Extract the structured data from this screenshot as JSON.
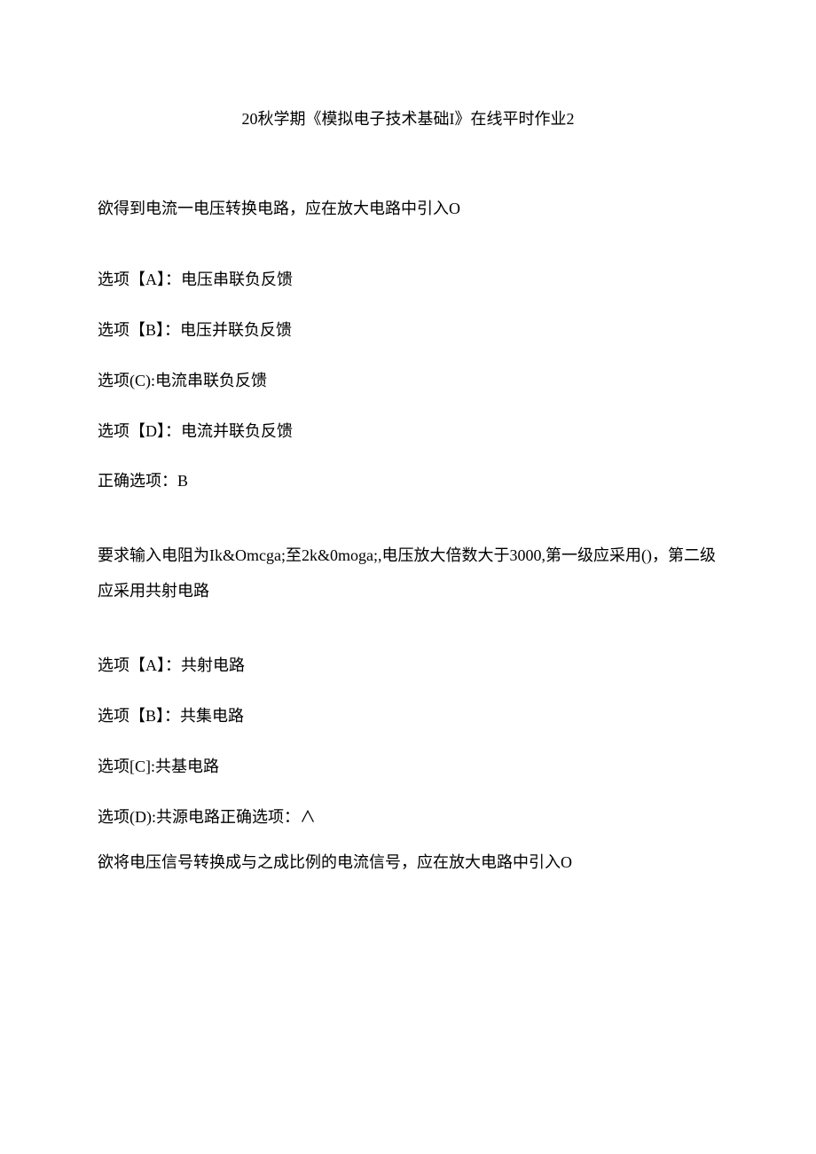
{
  "title": "20秋学期《模拟电子技术基础I》在线平时作业2",
  "q1": {
    "text": "欲得到电流一电压转换电路，应在放大电路中引入O",
    "optA": "选项【A】：电压串联负反馈",
    "optB": "选项【B】：电压并联负反馈",
    "optC": "选项(C):电流串联负反馈",
    "optD": "选项【D】：电流并联负反馈",
    "answer": "正确选项：B"
  },
  "q2": {
    "text": "要求输入电阻为Ik&Omcga;至2k&0moga;,电压放大倍数大于3000,第一级应采用()，第二级应采用共射电路",
    "optA": "选项【A】：共射电路",
    "optB": "选项【B】：共集电路",
    "optC": "选项[C]:共基电路",
    "optD": "选项(D):共源电路正确选项：∧"
  },
  "q3": {
    "text": "欲将电压信号转换成与之成比例的电流信号，应在放大电路中引入O"
  }
}
